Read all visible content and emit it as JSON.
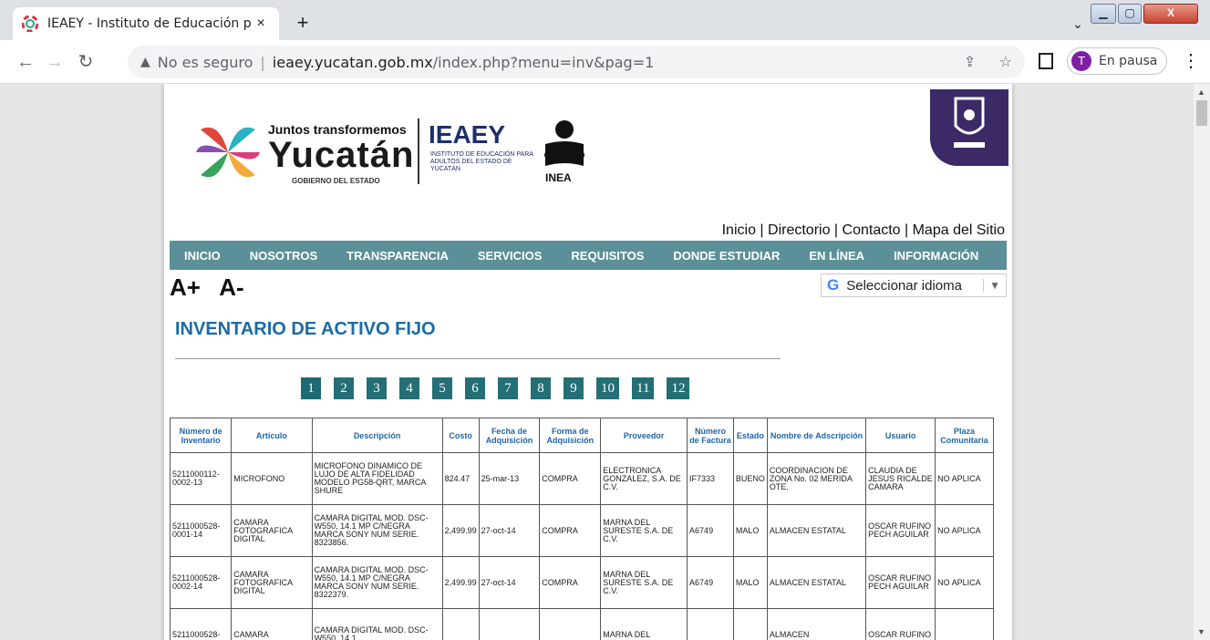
{
  "browser": {
    "tab_title": "IEAEY - Instituto de Educación pa",
    "close_glyph": "×",
    "new_tab_glyph": "+",
    "tab_search_glyph": "⌄",
    "insecure_label": "No es seguro",
    "url_host": "ieaey.yucatan.gob.mx",
    "url_path": "/index.php?menu=inv&pag=1",
    "profile_initial": "T",
    "profile_label": "En pausa",
    "win_min": "▁",
    "win_max": "▢",
    "win_close": "X",
    "share_icon": "⇪",
    "star_icon": "☆",
    "menu_glyph": "⋮"
  },
  "site": {
    "logo_line1": "Juntos transformemos",
    "logo_line2": "Yucatán",
    "logo_line3": "GOBIERNO DEL ESTADO",
    "ieaey": "IEAEY",
    "ieaey_sub": "INSTITUTO DE EDUCACIÓN PARA ADULTOS DEL ESTADO DE YUCATÁN",
    "inea": "INEA",
    "toplinks": "Inicio | Directorio | Contacto | Mapa del Sitio",
    "nav": [
      "INICIO",
      "NOSOTROS",
      "TRANSPARENCIA",
      "SERVICIOS",
      "REQUISITOS",
      "DONDE ESTUDIAR",
      "EN LÍNEA",
      "INFORMACIÓN"
    ],
    "font_plus": "A+",
    "font_minus": "A-",
    "translate_g": "G",
    "translate_label": "Seleccionar idioma",
    "translate_arrow": "▼"
  },
  "content": {
    "title": "INVENTARIO DE ACTIVO FIJO",
    "pages": [
      "1",
      "2",
      "3",
      "4",
      "5",
      "6",
      "7",
      "8",
      "9",
      "10",
      "11",
      "12"
    ],
    "current_page": "1",
    "headers": [
      "Número de Inventario",
      "Artículo",
      "Descripción",
      "Costo",
      "Fecha de Adquisición",
      "Forma de Adquisición",
      "Proveedor",
      "Número de Factura",
      "Estado",
      "Nombre de Adscripción",
      "Usuario",
      "Plaza Comunitaria"
    ],
    "rows": [
      [
        "5211000112-0002-13",
        "MICROFONO",
        "MICROFONO DINAMICO DE LUJO DE ALTA FIDELIDAD MODELO PG58-QRT, MARCA SHURE",
        "824.47",
        "25-mar-13",
        "COMPRA",
        "ELECTRONICA GONZALEZ, S.A. DE C.V.",
        "IF7333",
        "BUENO",
        "COORDINACION DE ZONA No. 02 MERIDA OTE.",
        "CLAUDIA DE JESUS RICALDE CAMARA",
        "NO APLICA"
      ],
      [
        "5211000528-0001-14",
        "CAMARA FOTOGRAFICA DIGITAL",
        "CAMARA DIGITAL MOD. DSC-W550, 14.1 MP C/NEGRA MARCA SONY NUM SERIE. 8323856.",
        "2,499.99",
        "27-oct-14",
        "COMPRA",
        "MARNA DEL SURESTE S.A. DE C.V.",
        "A6749",
        "MALO",
        "ALMACEN ESTATAL",
        "OSCAR RUFINO PECH AGUILAR",
        "NO APLICA"
      ],
      [
        "5211000528-0002-14",
        "CAMARA FOTOGRAFICA DIGITAL",
        "CAMARA DIGITAL MOD. DSC-W550, 14.1 MP C/NEGRA MARCA SONY NUM SERIE. 8322379.",
        "2,499.99",
        "27-oct-14",
        "COMPRA",
        "MARNA DEL SURESTE S.A. DE C.V.",
        "A6749",
        "MALO",
        "ALMACEN ESTATAL",
        "OSCAR RUFINO PECH AGUILAR",
        "NO APLICA"
      ],
      [
        "5211000528-",
        "CAMARA",
        "CAMARA DIGITAL MOD. DSC-W550, 14.1",
        "",
        "",
        "",
        "MARNA DEL",
        "",
        "",
        "ALMACEN",
        "OSCAR RUFINO",
        ""
      ]
    ]
  }
}
